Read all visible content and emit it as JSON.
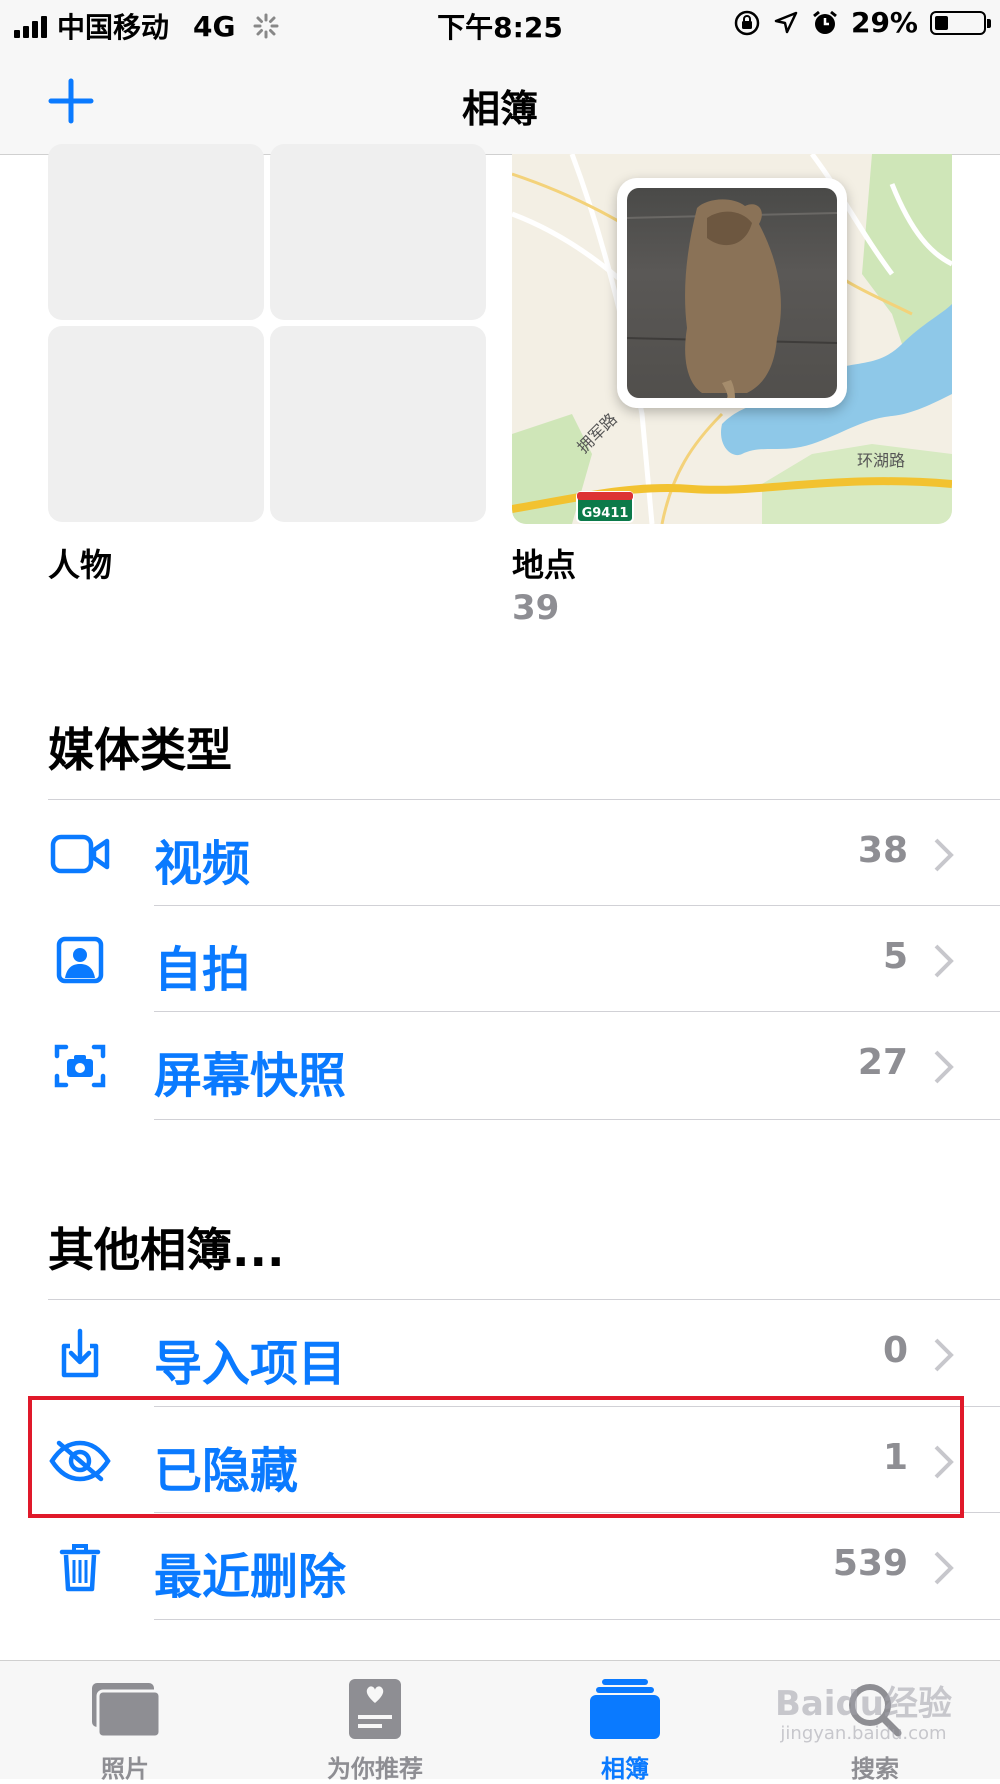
{
  "status": {
    "carrier": "中国移动",
    "network": "4G",
    "time": "下午8:25",
    "battery_percent": "29%",
    "battery_level": 0.29
  },
  "nav": {
    "title": "相簿",
    "add_icon": "plus-icon"
  },
  "tiles": {
    "people": {
      "label": "人物"
    },
    "places": {
      "label": "地点",
      "count": "39",
      "map_labels": [
        "拥军路",
        "环湖路",
        "G9411"
      ]
    }
  },
  "media_types": {
    "title": "媒体类型",
    "rows": [
      {
        "label": "视频",
        "count": "38",
        "icon": "video-icon"
      },
      {
        "label": "自拍",
        "count": "5",
        "icon": "selfie-icon"
      },
      {
        "label": "屏幕快照",
        "count": "27",
        "icon": "screenshot-icon"
      }
    ]
  },
  "other_albums": {
    "title": "其他相簿...",
    "rows": [
      {
        "label": "导入项目",
        "count": "0",
        "icon": "import-icon"
      },
      {
        "label": "已隐藏",
        "count": "1",
        "icon": "hidden-eye-icon"
      },
      {
        "label": "最近删除",
        "count": "539",
        "icon": "trash-icon"
      }
    ]
  },
  "tabbar": {
    "tabs": [
      {
        "label": "照片",
        "active": false
      },
      {
        "label": "为你推荐",
        "active": false
      },
      {
        "label": "相簿",
        "active": true
      },
      {
        "label": "搜索",
        "active": false
      }
    ]
  },
  "watermark": {
    "brand": "Baidu经验",
    "url": "jingyan.baidu.com"
  },
  "colors": {
    "accent": "#0a7aff",
    "secondary": "#8e8e93",
    "highlight": "#e0192a"
  }
}
